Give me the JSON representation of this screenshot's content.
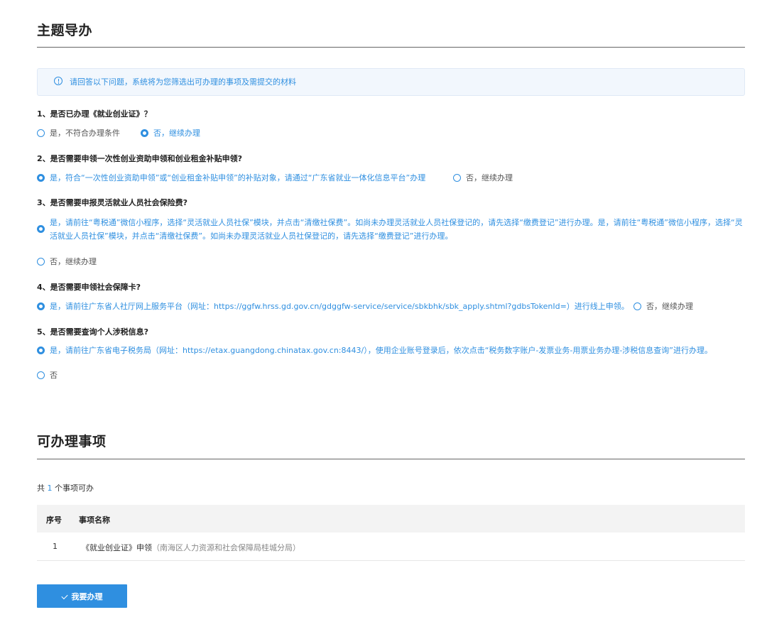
{
  "section1": {
    "title": "主题导办",
    "notice": "请回答以下问题，系统将为您筛选出可办理的事项及需提交的材料"
  },
  "questions": [
    {
      "label": "1、是否已办理《就业创业证》？",
      "options": [
        {
          "text": "是，不符合办理条件",
          "checked": false
        },
        {
          "text": "否，继续办理",
          "checked": true
        }
      ]
    },
    {
      "label": "2、是否需要申领一次性创业资助申领和创业租金补贴申领?",
      "options": [
        {
          "text": "是，符合“一次性创业资助申领”或“创业租金补贴申领”的补贴对象，请通过“广东省就业一体化信息平台”办理",
          "checked": true
        },
        {
          "text": "否，继续办理",
          "checked": false
        }
      ]
    },
    {
      "label": "3、是否需要申报灵活就业人员社会保险费?",
      "options": [
        {
          "text": "是，请前往“粤税通”微信小程序，选择“灵活就业人员社保”模块，并点击“清缴社保费”。如尚未办理灵活就业人员社保登记的，请先选择“缴费登记”进行办理。是，请前往“粤税通”微信小程序，选择“灵活就业人员社保”模块，并点击“清缴社保费”。如尚未办理灵活就业人员社保登记的，请先选择“缴费登记”进行办理。",
          "checked": true
        },
        {
          "text": "否，继续办理",
          "checked": false
        }
      ]
    },
    {
      "label": "4、是否需要申领社会保障卡?",
      "options": [
        {
          "text": "是，请前往广东省人社厅网上服务平台（网址：https://ggfw.hrss.gd.gov.cn/gdggfw-service/service/sbkbhk/sbk_apply.shtml?gdbsTokenId=）进行线上申领。",
          "checked": true
        },
        {
          "text": "否，继续办理",
          "checked": false
        }
      ]
    },
    {
      "label": "5、是否需要查询个人涉税信息?",
      "options": [
        {
          "text": "是，请前往广东省电子税务局（网址：https://etax.guangdong.chinatax.gov.cn:8443/），使用企业账号登录后，依次点击“税务数字账户-发票业务-用票业务办理-涉税信息查询”进行办理。",
          "checked": true
        },
        {
          "text": "否",
          "checked": false
        }
      ]
    }
  ],
  "section2": {
    "title": "可办理事项",
    "count_prefix": "共",
    "count": "1",
    "count_suffix": "个事项可办",
    "columns": [
      "序号",
      "事项名称"
    ],
    "rows": [
      {
        "index": "1",
        "name": "《就业创业证》申领",
        "dept": "（南海区人力资源和社会保障局桂城分局）"
      }
    ],
    "button_label": "我要办理"
  },
  "colors": {
    "accent": "#2f8fe0",
    "notice_bg": "#f2f7fd",
    "table_head_bg": "#f3f3f3"
  },
  "icons": {
    "notice": "info-circle-icon",
    "button": "check-icon"
  }
}
